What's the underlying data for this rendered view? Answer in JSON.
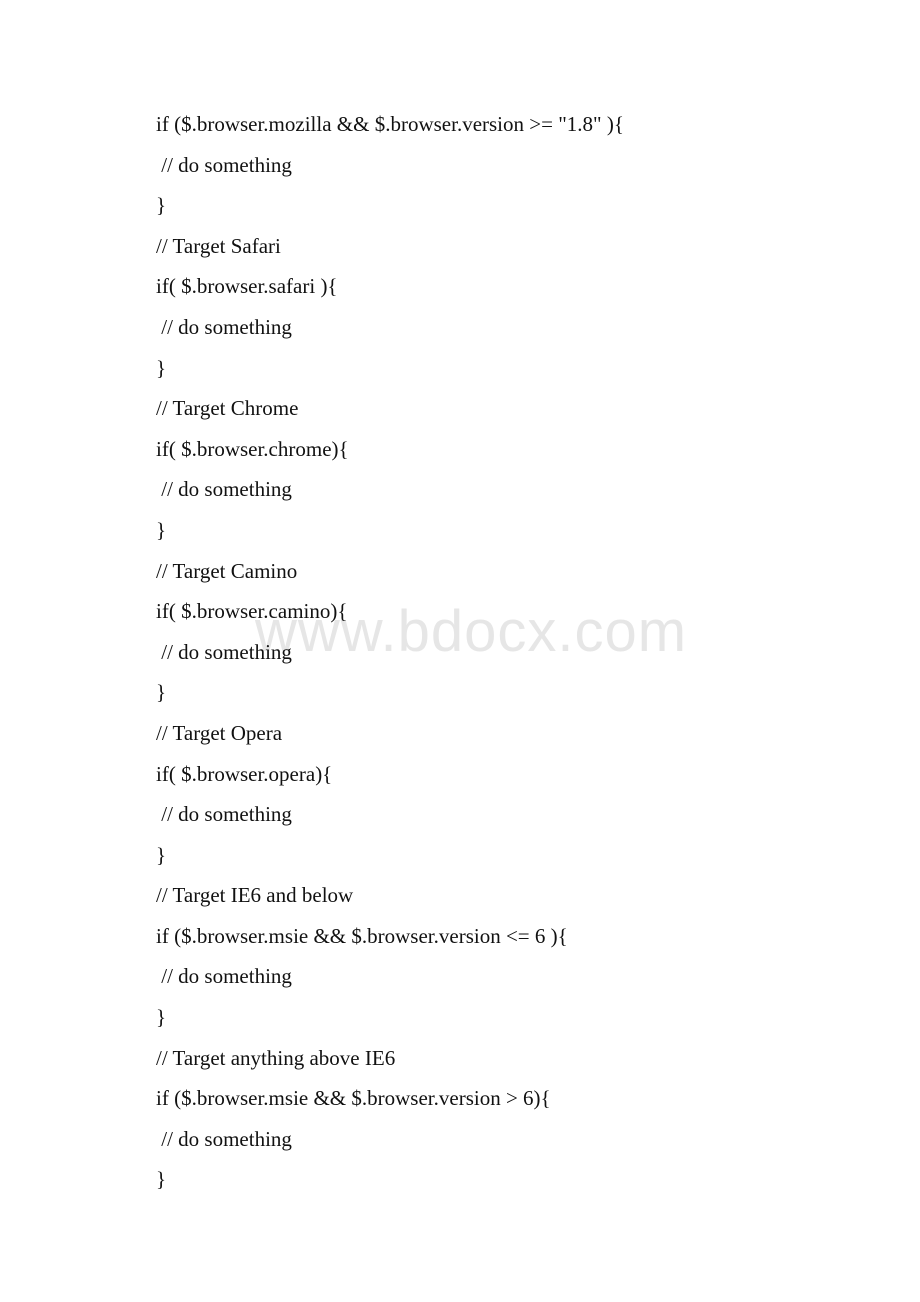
{
  "watermark": "www.bdocx.com",
  "lines": [
    "if ($.browser.mozilla && $.browser.version >= \"1.8\" ){",
    " // do something",
    "}",
    "// Target Safari",
    "if( $.browser.safari ){",
    " // do something",
    "}",
    "// Target Chrome",
    "if( $.browser.chrome){",
    " // do something",
    "}",
    "// Target Camino",
    "if( $.browser.camino){",
    " // do something",
    "}",
    "// Target Opera",
    "if( $.browser.opera){",
    " // do something",
    "}",
    "// Target IE6 and below",
    "if ($.browser.msie && $.browser.version <= 6 ){",
    " // do something",
    "}",
    "// Target anything above IE6",
    "if ($.browser.msie && $.browser.version > 6){",
    " // do something",
    "}"
  ]
}
